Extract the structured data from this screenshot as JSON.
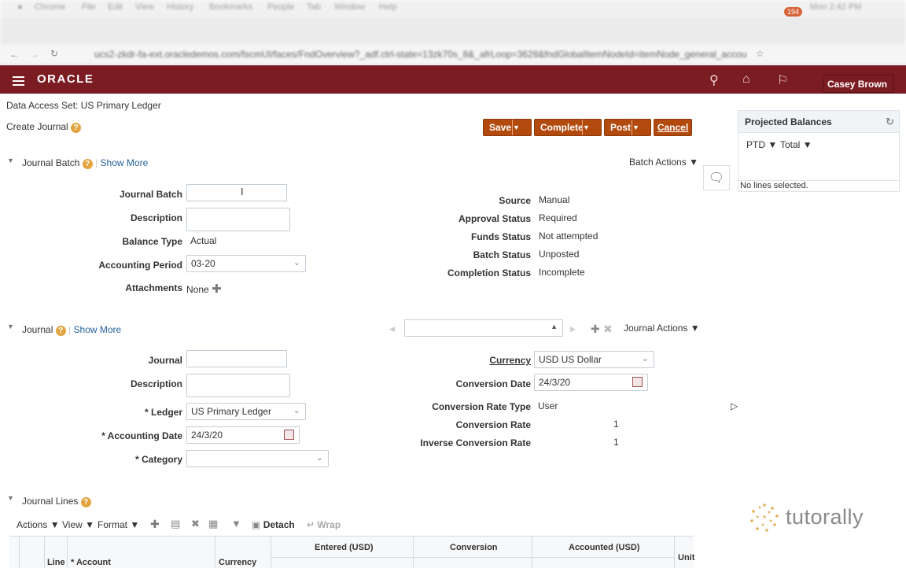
{
  "browser": {
    "menu": [
      "Chrome",
      "File",
      "Edit",
      "View",
      "History",
      "Bookmarks",
      "People",
      "Tab",
      "Window",
      "Help"
    ],
    "clock": "Mon 2:42 PM",
    "url": "ucs2-zkdr-fa-ext.oracledemos.com/fscmUI/faces/FndOverview?_adf.ctrl-state=13zk70s_8&_afrLoop=3628&fndGlobalItemNodeId=itemNode_general_accounting_journals"
  },
  "header": {
    "logo": "ORACLE",
    "notification_count": "194",
    "user": "Casey Brown"
  },
  "page": {
    "data_access_label": "Data Access Set:",
    "data_access_value": "US Primary Ledger",
    "title": "Create Journal"
  },
  "toolbar": {
    "save": "Save",
    "complete": "Complete",
    "post": "Post",
    "cancel": "Cancel"
  },
  "batch": {
    "section_title": "Journal Batch",
    "show_more": "Show More",
    "actions": "Batch Actions",
    "fields": {
      "journal_batch": {
        "label": "Journal Batch",
        "value": ""
      },
      "description": {
        "label": "Description",
        "value": ""
      },
      "balance_type": {
        "label": "Balance Type",
        "value": "Actual"
      },
      "accounting_period": {
        "label": "Accounting Period",
        "value": "03-20"
      },
      "attachments": {
        "label": "Attachments",
        "value": "None"
      }
    },
    "status": {
      "source": {
        "label": "Source",
        "value": "Manual"
      },
      "approval": {
        "label": "Approval Status",
        "value": "Required"
      },
      "funds": {
        "label": "Funds Status",
        "value": "Not attempted"
      },
      "batch": {
        "label": "Batch Status",
        "value": "Unposted"
      },
      "completion": {
        "label": "Completion Status",
        "value": "Incomplete"
      }
    }
  },
  "journal": {
    "section_title": "Journal",
    "show_more": "Show More",
    "actions": "Journal Actions",
    "fields": {
      "journal": {
        "label": "Journal",
        "value": ""
      },
      "description": {
        "label": "Description",
        "value": ""
      },
      "ledger": {
        "label": "Ledger",
        "value": "US Primary Ledger"
      },
      "accounting_date": {
        "label": "Accounting Date",
        "value": "24/3/20"
      },
      "category": {
        "label": "Category",
        "value": ""
      }
    },
    "currency": {
      "currency": {
        "label": "Currency",
        "value": "USD US Dollar"
      },
      "conversion_date": {
        "label": "Conversion Date",
        "value": "24/3/20"
      },
      "rate_type": {
        "label": "Conversion Rate Type",
        "value": "User"
      },
      "rate": {
        "label": "Conversion Rate",
        "value": "1"
      },
      "inverse_rate": {
        "label": "Inverse Conversion Rate",
        "value": "1"
      }
    }
  },
  "lines": {
    "section_title": "Journal Lines",
    "toolbar": {
      "actions": "Actions",
      "view": "View",
      "format": "Format",
      "detach": "Detach",
      "wrap": "Wrap"
    },
    "columns": {
      "line": "Line",
      "account": "Account",
      "currency": "Currency",
      "entered": "Entered (USD)",
      "conversion": "Conversion",
      "accounted": "Accounted (USD)",
      "unit": "Unit"
    }
  },
  "projected": {
    "title": "Projected Balances",
    "ptd": "PTD",
    "total": "Total",
    "empty": "No lines selected."
  },
  "watermark": "tutorally",
  "colors": {
    "brand": "#7b1c22",
    "button": "#b24a0e",
    "link": "#1f5f9a",
    "help": "#e2a43f"
  }
}
